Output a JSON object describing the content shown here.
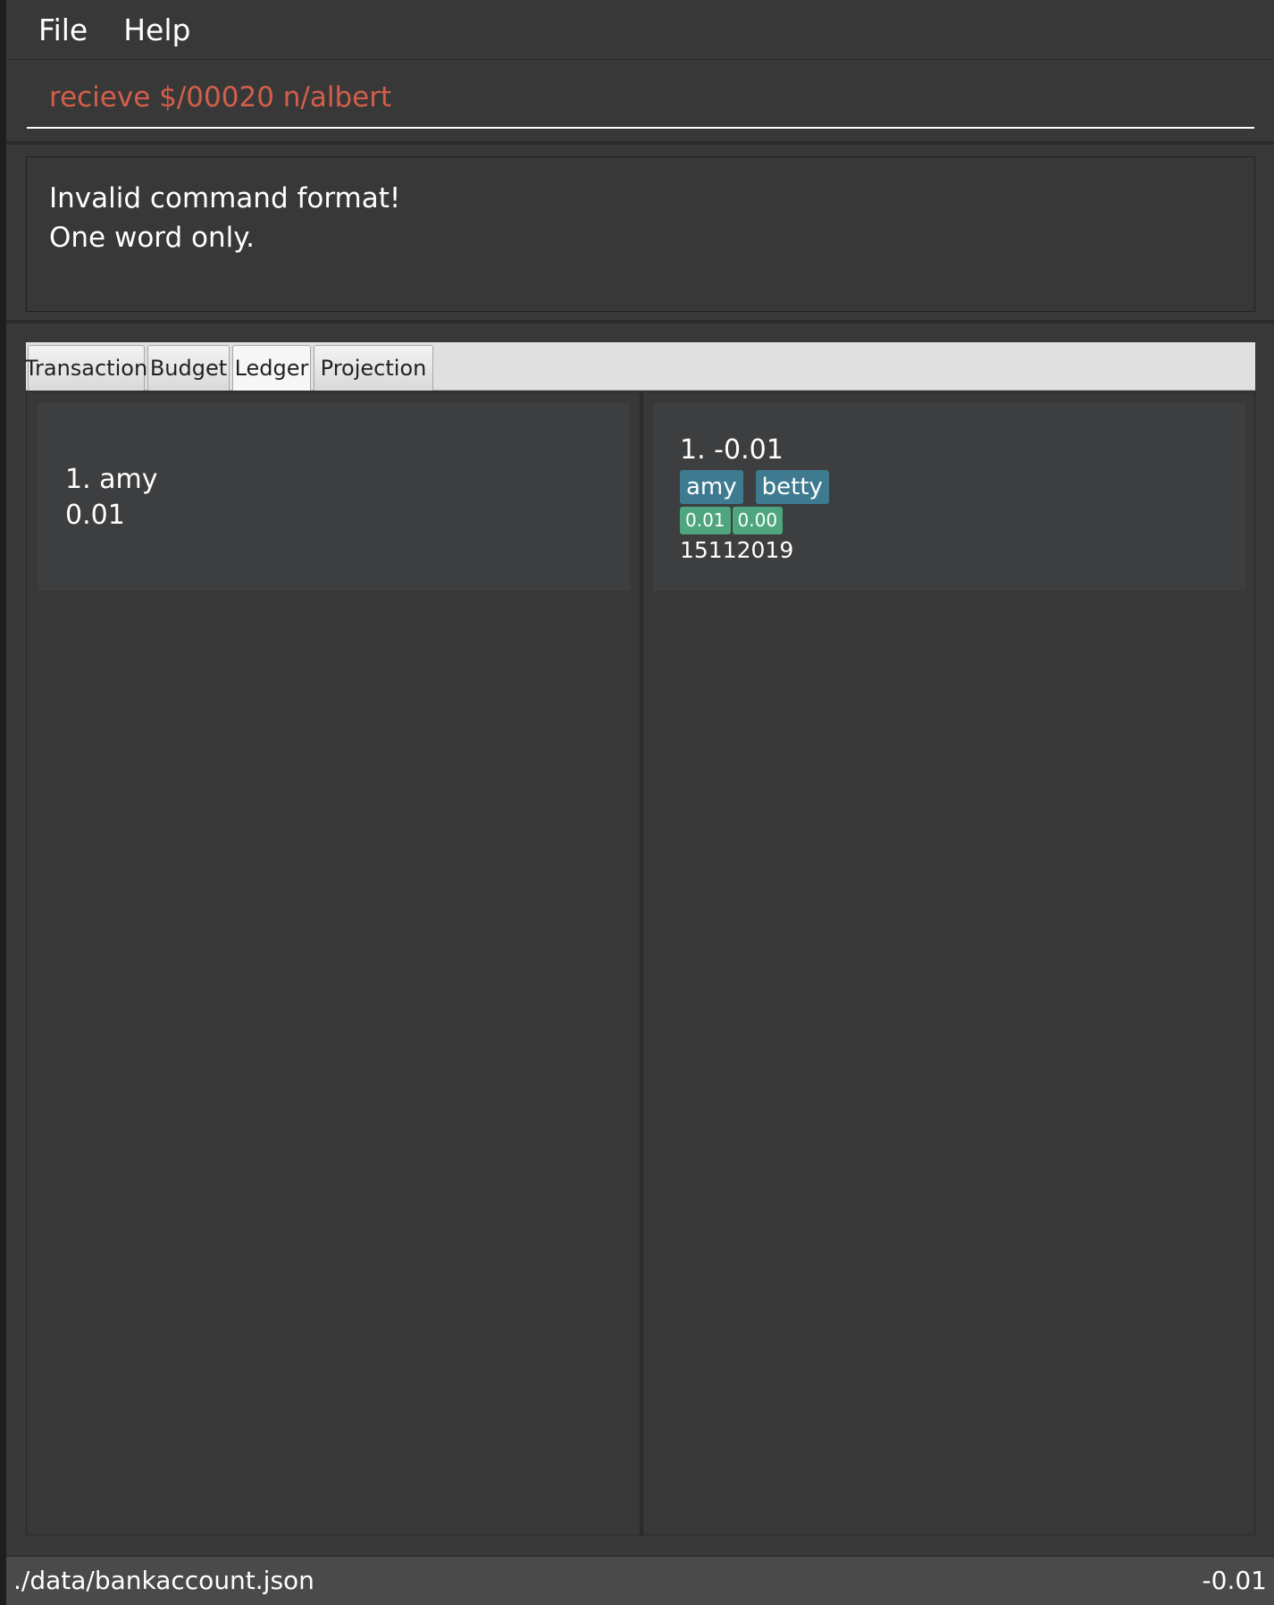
{
  "menu": {
    "file_label": "File",
    "help_label": "Help"
  },
  "command": {
    "value": "recieve $/00020 n/albert",
    "color": "#d35f4a"
  },
  "result": {
    "lines": [
      "Invalid command format!",
      "One word only."
    ]
  },
  "tabs": [
    {
      "label": "Transaction",
      "selected": false
    },
    {
      "label": "Budget",
      "selected": false
    },
    {
      "label": "Ledger",
      "selected": true
    },
    {
      "label": "Projection",
      "selected": false
    }
  ],
  "ledger": {
    "people": [
      {
        "index_name": "1.  amy",
        "amount": "0.01"
      }
    ],
    "transactions": [
      {
        "title": "1.  -0.01",
        "people": [
          "amy",
          "betty"
        ],
        "amounts": [
          "0.01",
          "0.00"
        ],
        "date": "15112019"
      }
    ]
  },
  "status": {
    "file_path": "./data/bankaccount.json",
    "balance": "-0.01"
  },
  "colors": {
    "background": "#383838",
    "person_tag": "#3e7b91",
    "amount_tag": "#4fa67e",
    "error_text": "#d35f4a"
  }
}
